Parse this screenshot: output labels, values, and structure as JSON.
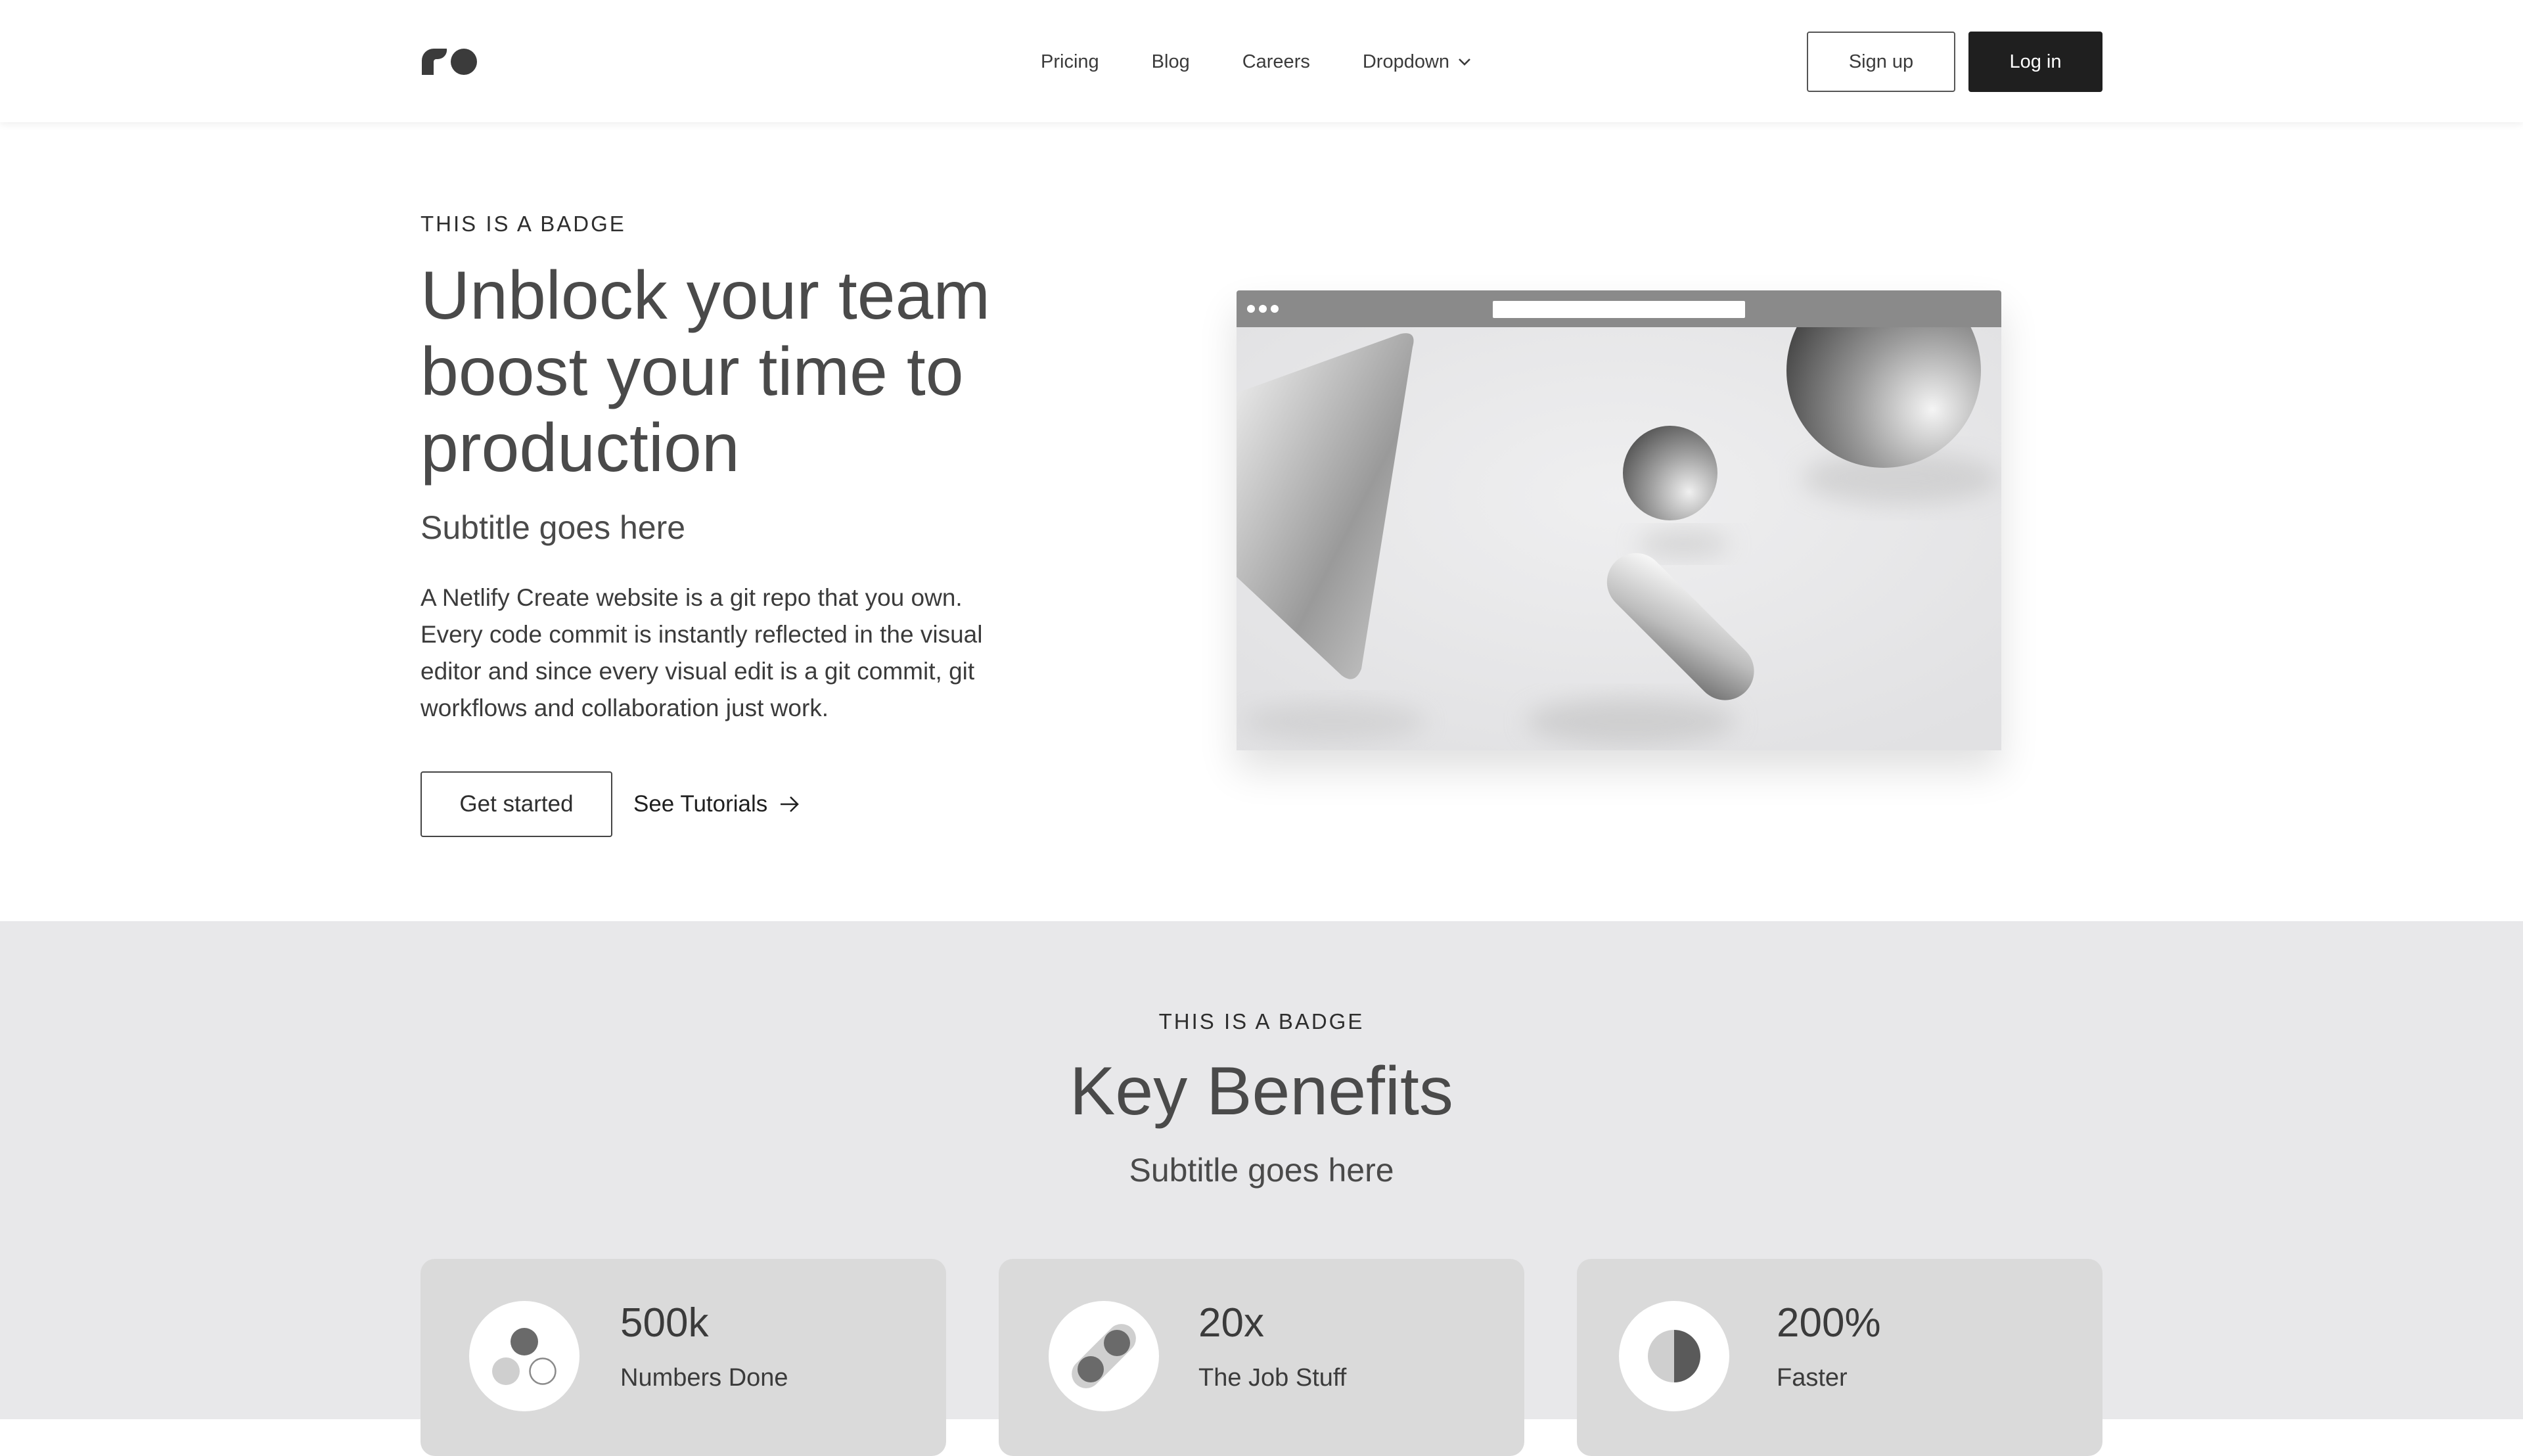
{
  "header": {
    "logo_icon": "brand-logo-icon",
    "nav": [
      {
        "label": "Pricing"
      },
      {
        "label": "Blog"
      },
      {
        "label": "Careers"
      },
      {
        "label": "Dropdown",
        "icon": "chevron-down-icon"
      }
    ],
    "signup_label": "Sign up",
    "login_label": "Log in"
  },
  "hero": {
    "badge": "THIS IS A BADGE",
    "title": "Unblock your team boost your time to production",
    "subtitle": "Subtitle goes here",
    "body": "A Netlify Create website is a git repo that you own. Every code commit is instantly reflected in the visual editor and since every visual edit is a git commit, git workflows and collaboration just work.",
    "primary_cta": "Get started",
    "secondary_cta": "See Tutorials",
    "secondary_icon": "arrow-right-icon"
  },
  "benefits": {
    "badge": "THIS IS A BADGE",
    "title": "Key Benefits",
    "subtitle": "Subtitle goes here",
    "cards": [
      {
        "value": "500k",
        "label": "Numbers Done",
        "icon": "circles-icon"
      },
      {
        "value": "20x",
        "label": "The Job Stuff",
        "icon": "pill-dots-icon"
      },
      {
        "value": "200%",
        "label": "Faster",
        "icon": "half-circle-icon"
      }
    ]
  },
  "colors": {
    "accent_dark": "#1f1f1f",
    "section_bg": "#e8e8ea",
    "card_bg": "#dadada"
  }
}
